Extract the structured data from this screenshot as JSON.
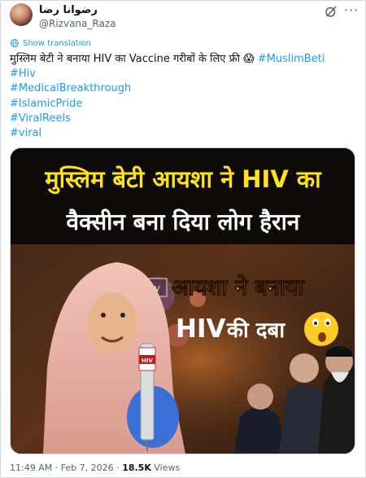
{
  "header": {
    "display_name": "رضوانا رضا",
    "handle": "@Rizvana_Raza"
  },
  "translation_link": "Show translation",
  "tweet": {
    "text_line": "मुस्लिम बेटी ने बनाया HIV का Vaccine गरीबों के लिए फ्री 😱",
    "first_hashtag": "#MuslimBeti",
    "hashtags": [
      "#Hiv",
      "#MedicalBreakthrough",
      "#IslamicPride",
      "#ViralReels",
      "#viral"
    ]
  },
  "media": {
    "headline_line1": "मुस्लिम बेटी आयशा ने HIV का",
    "headline_line2": "वैक्सीन बना दिया लोग हैरान",
    "callout_line1": "आयशा ने बनाया",
    "callout_line2_a": "HIV",
    "callout_line2_b": "की दबा",
    "vial_label": "HIV",
    "box_label": "HIV",
    "colors": {
      "headline_yellow": "#ffe21a",
      "callout_orange": "#ff9a1f",
      "dark_band": "#0d0a08"
    }
  },
  "footer": {
    "time": "11:49 AM",
    "separator": "·",
    "date": "Feb 7, 2026",
    "separator2": "·",
    "views_count": "18.5K",
    "views_label": "Views"
  },
  "colors": {
    "accent": "#1d9bf0",
    "muted": "#536471"
  }
}
